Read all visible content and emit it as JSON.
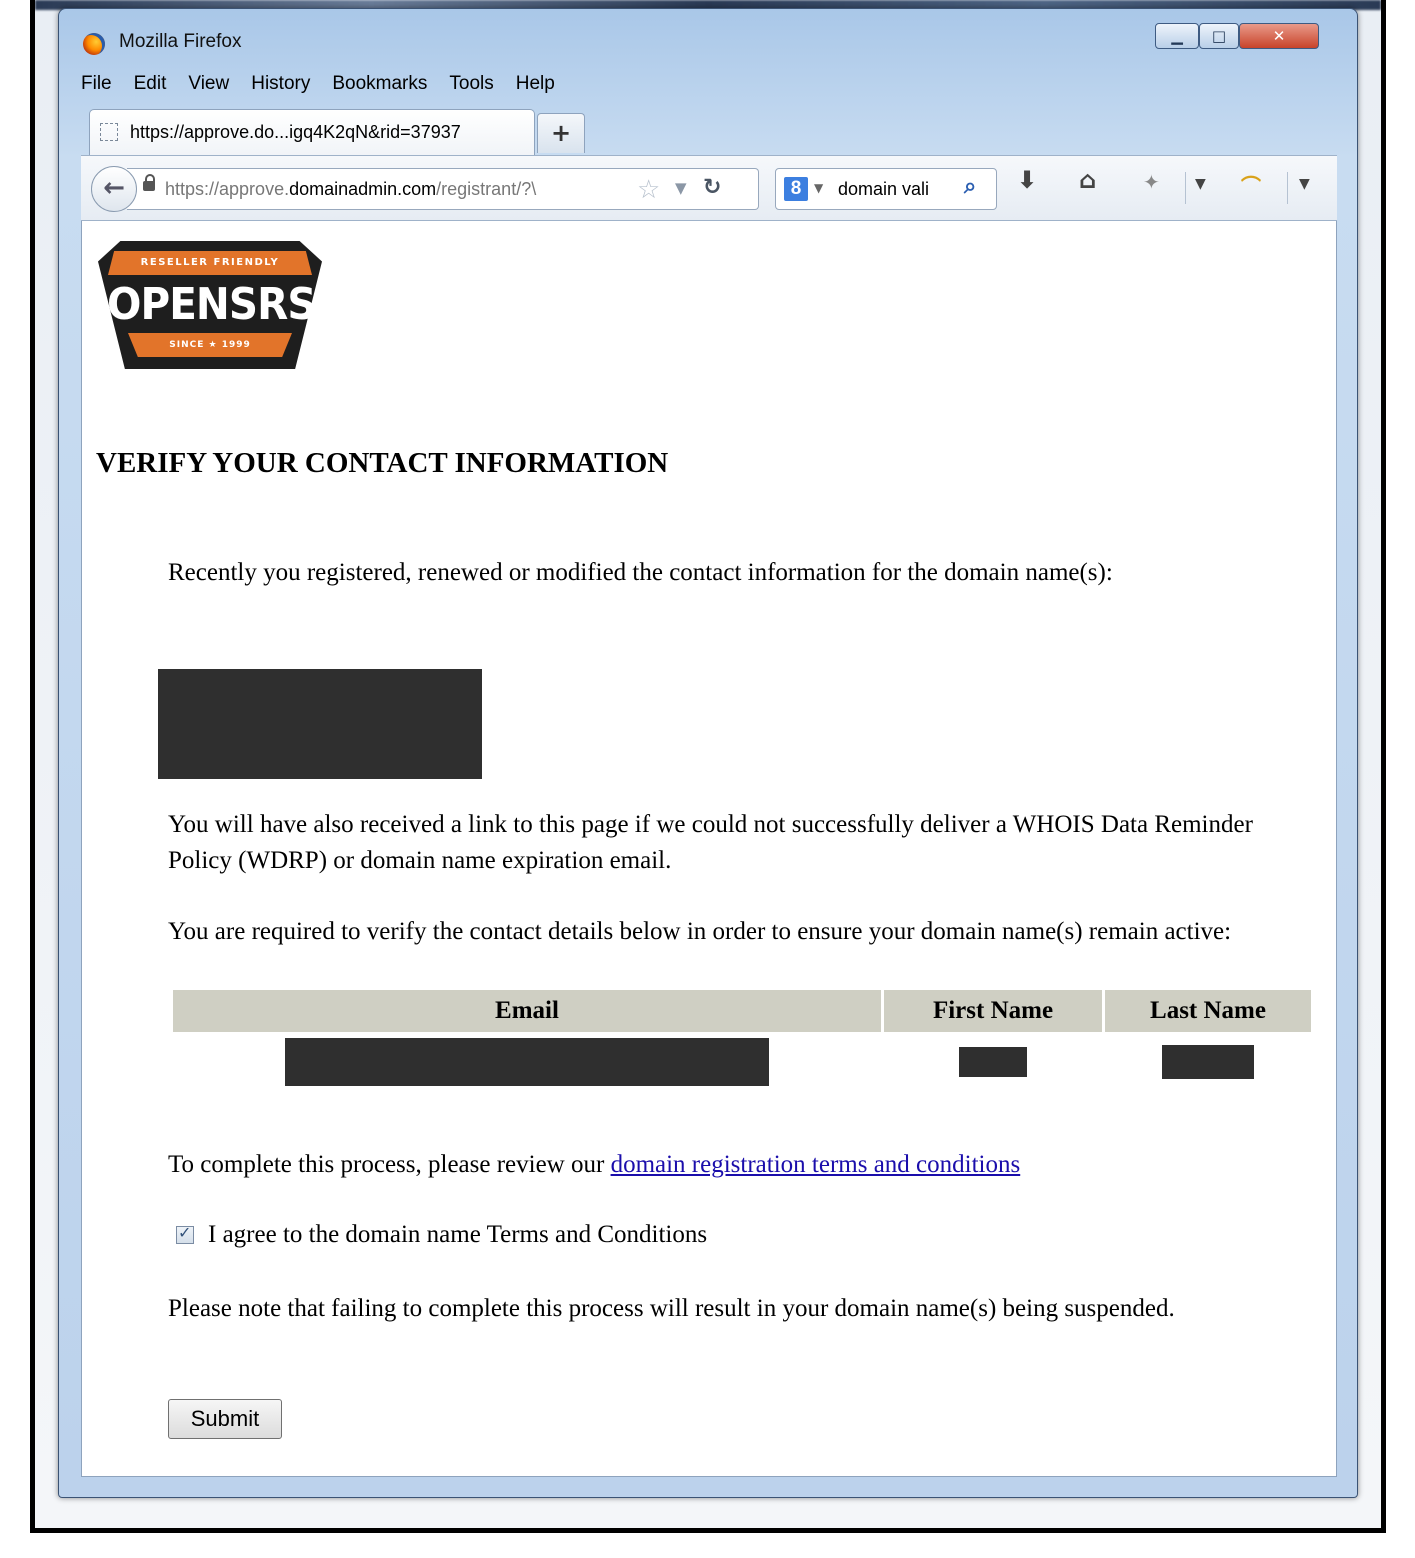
{
  "window": {
    "title": "Mozilla Firefox",
    "controls": {
      "minimize": "▁",
      "maximize": "□",
      "close": "✕"
    }
  },
  "menu": [
    "File",
    "Edit",
    "View",
    "History",
    "Bookmarks",
    "Tools",
    "Help"
  ],
  "tab": {
    "title": "https://approve.do...igq4K2qN&rid=37937",
    "new_tab": "+"
  },
  "navbar": {
    "url_prefix": "https://approve.",
    "url_domain": "domainadmin.com",
    "url_path": "/registrant/?\\",
    "search_engine_icon": "8",
    "search_text": "domain vali"
  },
  "icons": {
    "back": "back-arrow-icon",
    "lock": "lock-icon",
    "bookmark": "star-icon",
    "reload": "reload-icon",
    "search": "magnifier-icon",
    "download": "download-icon",
    "home": "home-icon",
    "addon": "addon-icon",
    "rainbow": "rainbow-icon"
  },
  "logo": {
    "top": "RESELLER FRIENDLY",
    "brand": "OPENSRS",
    "bottom": "SINCE ★ 1999"
  },
  "page": {
    "heading": "VERIFY YOUR CONTACT INFORMATION",
    "intro": "Recently you registered, renewed or modified the contact information for the domain name(s):",
    "wdrp": "You will have also received a link to this page if we could not successfully deliver a WHOIS Data Reminder Policy (WDRP) or domain name expiration email.",
    "required": "You are required to verify the contact details below in order to ensure your domain name(s) remain active:",
    "table": {
      "headers": [
        "Email",
        "First Name",
        "Last Name"
      ]
    },
    "review_text": "To complete this process, please review our ",
    "review_link": "domain registration terms and conditions",
    "agree_label": "I agree to the domain name Terms and Conditions",
    "agree_checked": true,
    "note": "Please note that failing to complete this process will result in your domain name(s) being suspended.",
    "submit": "Submit"
  }
}
